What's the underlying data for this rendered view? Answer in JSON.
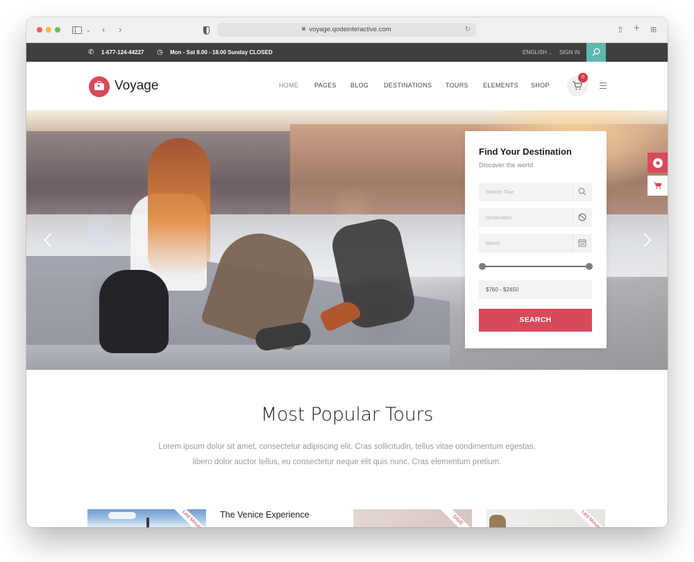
{
  "browser": {
    "url": "voyage.qodeinteractive.com"
  },
  "topbar": {
    "phone": "1-677-124-44227",
    "hours": "Mon - Sat 8.00 - 18.00 Sunday CLOSED",
    "language": "ENGLISH",
    "sign_in": "SIGN IN"
  },
  "header": {
    "brand": "Voyage",
    "nav": [
      "HOME",
      "PAGES",
      "BLOG",
      "DESTINATIONS",
      "TOURS",
      "ELEMENTS",
      "SHOP"
    ],
    "cart_count": "0"
  },
  "search_card": {
    "title": "Find Your Destination",
    "subtitle": "Discover the world",
    "search_placeholder": "Search Tour",
    "destination_placeholder": "Destination",
    "month_placeholder": "Month",
    "price_range": "$760 - $2450",
    "price_slider": {
      "min": 760,
      "max": 2450
    },
    "search_button": "SEARCH"
  },
  "popular": {
    "title": "Most Popular Tours",
    "lead_line1": "Lorem ipsum dolor sit amet, consectetur adipiscing elit. Cras sollicitudin, tellus vitae condimentum egestas,",
    "lead_line2": "libero dolor auctor tellus, eu consectetur neque elit quis nunc. Cras elementum pretium.",
    "tours": [
      {
        "title": "The Venice Experience",
        "ribbon": "Last Minute"
      },
      {
        "ribbon": "SAVE"
      },
      {
        "ribbon": "Last Minute"
      }
    ]
  },
  "colors": {
    "accent": "#d84a59",
    "teal": "#5eb8b1",
    "topbar": "#3f3f3f"
  }
}
